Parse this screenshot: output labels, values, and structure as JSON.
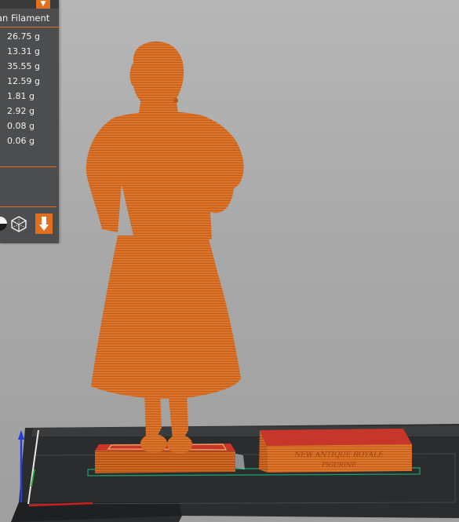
{
  "stats_panel": {
    "dropdown_glyph": "▼",
    "column_header": "an Filament",
    "weights": [
      "26.75 g",
      "13.31 g",
      "35.55 g",
      "12.59 g",
      "1.81 g",
      "2.92 g",
      "0.08 g",
      "0.06 g"
    ]
  },
  "colors": {
    "accent": "#e07020",
    "model": "#e0762a",
    "model_top": "#c83828",
    "plate": "#303234",
    "panel_bg": "#4b4d4f"
  },
  "scene": {
    "objects": [
      "figurine-woman",
      "base-plinth-left",
      "base-plinth-right"
    ],
    "icons": [
      "sphere-view-icon",
      "cube-view-icon",
      "down-arrow-icon"
    ]
  }
}
